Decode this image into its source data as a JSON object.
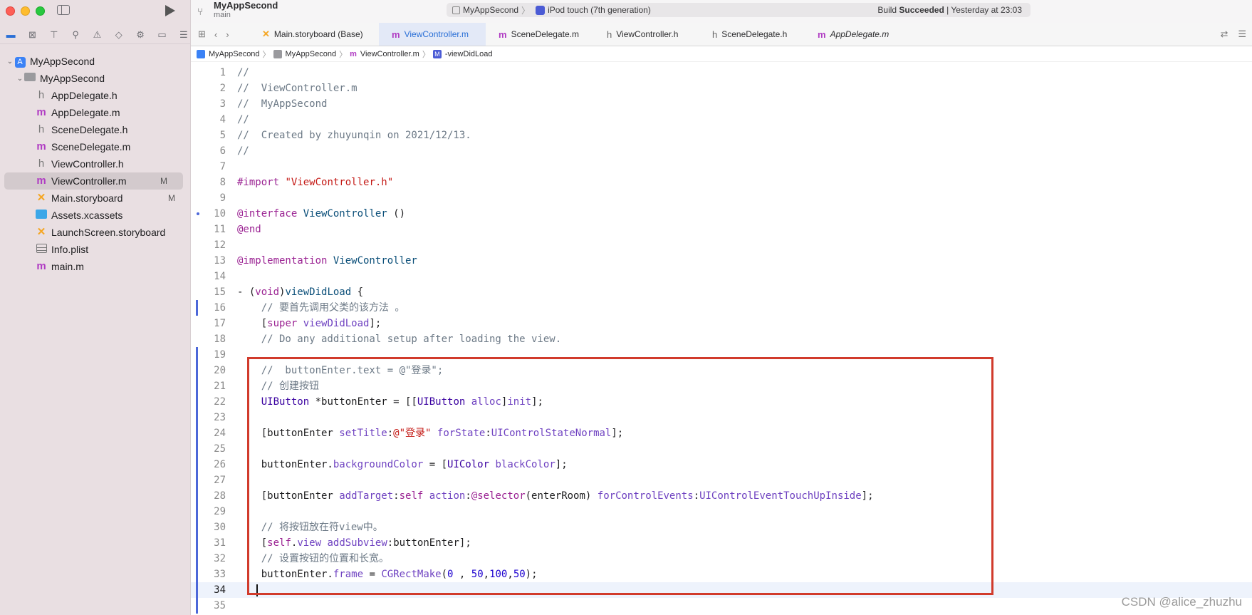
{
  "window": {
    "title": "MyAppSecond",
    "branch": "main"
  },
  "toolbar": {
    "scheme_name": "MyAppSecond",
    "device_name": "iPod touch (7th generation)",
    "build_prefix": "Build ",
    "build_result": "Succeeded",
    "build_time": " | Yesterday at 23:03"
  },
  "navigator": {
    "icons": [
      "folder-icon",
      "source-control-icon",
      "hierarchy-icon",
      "search-icon",
      "warning-icon",
      "test-icon",
      "debug-icon",
      "breakpoint-icon",
      "report-icon"
    ]
  },
  "tree": {
    "project": "MyAppSecond",
    "group": "MyAppSecond",
    "files": [
      {
        "name": "AppDelegate.h",
        "kind": "h",
        "badge": ""
      },
      {
        "name": "AppDelegate.m",
        "kind": "m",
        "badge": ""
      },
      {
        "name": "SceneDelegate.h",
        "kind": "h",
        "badge": ""
      },
      {
        "name": "SceneDelegate.m",
        "kind": "m",
        "badge": ""
      },
      {
        "name": "ViewController.h",
        "kind": "h",
        "badge": ""
      },
      {
        "name": "ViewController.m",
        "kind": "m",
        "badge": "M"
      },
      {
        "name": "Main.storyboard",
        "kind": "storyboard",
        "badge": "M"
      },
      {
        "name": "Assets.xcassets",
        "kind": "assets",
        "badge": ""
      },
      {
        "name": "LaunchScreen.storyboard",
        "kind": "storyboard",
        "badge": ""
      },
      {
        "name": "Info.plist",
        "kind": "plist",
        "badge": ""
      },
      {
        "name": "main.m",
        "kind": "m",
        "badge": ""
      }
    ]
  },
  "tabs": [
    {
      "label": "Main.storyboard (Base)",
      "icon": "X"
    },
    {
      "label": "ViewController.m",
      "icon": "m"
    },
    {
      "label": "SceneDelegate.m",
      "icon": "m"
    },
    {
      "label": "ViewController.h",
      "icon": "h"
    },
    {
      "label": "SceneDelegate.h",
      "icon": "h"
    },
    {
      "label": "AppDelegate.m",
      "icon": "m"
    }
  ],
  "jumpbar": [
    "MyAppSecond",
    "MyAppSecond",
    "ViewController.m",
    "-viewDidLoad"
  ],
  "editor": {
    "lines": [
      {
        "n": "1",
        "t": [
          [
            "cm",
            "//"
          ]
        ]
      },
      {
        "n": "2",
        "t": [
          [
            "cm",
            "//  ViewController.m"
          ]
        ]
      },
      {
        "n": "3",
        "t": [
          [
            "cm",
            "//  MyAppSecond"
          ]
        ]
      },
      {
        "n": "4",
        "t": [
          [
            "cm",
            "//"
          ]
        ]
      },
      {
        "n": "5",
        "t": [
          [
            "cm",
            "//  Created by zhuyunqin on 2021/12/13."
          ]
        ]
      },
      {
        "n": "6",
        "t": [
          [
            "cm",
            "//"
          ]
        ]
      },
      {
        "n": "7",
        "t": []
      },
      {
        "n": "8",
        "t": [
          [
            "kw",
            "#import "
          ],
          [
            "str",
            "\"ViewController.h\""
          ]
        ]
      },
      {
        "n": "9",
        "t": []
      },
      {
        "n": "10",
        "t": [
          [
            "kw",
            "@interface "
          ],
          [
            "ty",
            "ViewController"
          ],
          [
            "plain",
            " ()"
          ]
        ]
      },
      {
        "n": "11",
        "t": [
          [
            "kw",
            "@end"
          ]
        ]
      },
      {
        "n": "12",
        "t": []
      },
      {
        "n": "13",
        "t": [
          [
            "kw",
            "@implementation "
          ],
          [
            "ty",
            "ViewController"
          ]
        ]
      },
      {
        "n": "14",
        "t": []
      },
      {
        "n": "15",
        "t": [
          [
            "plain",
            "- ("
          ],
          [
            "kw",
            "void"
          ],
          [
            "plain",
            ")"
          ],
          [
            "ty",
            "viewDidLoad"
          ],
          [
            "plain",
            " {"
          ]
        ]
      },
      {
        "n": "16",
        "t": [
          [
            "cm",
            "    // 要首先调用父类的该方法 。"
          ]
        ]
      },
      {
        "n": "17",
        "t": [
          [
            "plain",
            "    ["
          ],
          [
            "kw",
            "super"
          ],
          [
            "plain",
            " "
          ],
          [
            "mt",
            "viewDidLoad"
          ],
          [
            "plain",
            "];"
          ]
        ]
      },
      {
        "n": "18",
        "t": [
          [
            "cm",
            "    // Do any additional setup after loading the view."
          ]
        ]
      },
      {
        "n": "19",
        "t": []
      },
      {
        "n": "20",
        "t": [
          [
            "cm",
            "    //  buttonEnter.text = @\"登录\";"
          ]
        ]
      },
      {
        "n": "21",
        "t": [
          [
            "cm",
            "    // 创建按钮"
          ]
        ]
      },
      {
        "n": "22",
        "t": [
          [
            "cls",
            "    UIButton"
          ],
          [
            "plain",
            " *buttonEnter = [["
          ],
          [
            "cls",
            "UIButton"
          ],
          [
            "plain",
            " "
          ],
          [
            "mt",
            "alloc"
          ],
          [
            "plain",
            "]"
          ],
          [
            "mt",
            "init"
          ],
          [
            "plain",
            "];"
          ]
        ]
      },
      {
        "n": "23",
        "t": []
      },
      {
        "n": "24",
        "t": [
          [
            "plain",
            "    [buttonEnter "
          ],
          [
            "mt",
            "setTitle"
          ],
          [
            "plain",
            ":"
          ],
          [
            "str",
            "@\"登录\""
          ],
          [
            "plain",
            " "
          ],
          [
            "mt",
            "forState"
          ],
          [
            "plain",
            ":"
          ],
          [
            "mt",
            "UIControlStateNormal"
          ],
          [
            "plain",
            "];"
          ]
        ]
      },
      {
        "n": "25",
        "t": []
      },
      {
        "n": "26",
        "t": [
          [
            "plain",
            "    buttonEnter."
          ],
          [
            "mt",
            "backgroundColor"
          ],
          [
            "plain",
            " = ["
          ],
          [
            "cls",
            "UIColor"
          ],
          [
            "plain",
            " "
          ],
          [
            "mt",
            "blackColor"
          ],
          [
            "plain",
            "];"
          ]
        ]
      },
      {
        "n": "27",
        "t": []
      },
      {
        "n": "28",
        "t": [
          [
            "plain",
            "    [buttonEnter "
          ],
          [
            "mt",
            "addTarget"
          ],
          [
            "plain",
            ":"
          ],
          [
            "kw",
            "self"
          ],
          [
            "plain",
            " "
          ],
          [
            "mt",
            "action"
          ],
          [
            "plain",
            ":"
          ],
          [
            "kw",
            "@selector"
          ],
          [
            "plain",
            "(enterRoom) "
          ],
          [
            "mt",
            "forControlEvents"
          ],
          [
            "plain",
            ":"
          ],
          [
            "mt",
            "UIControlEventTouchUpInside"
          ],
          [
            "plain",
            "];"
          ]
        ]
      },
      {
        "n": "29",
        "t": []
      },
      {
        "n": "30",
        "t": [
          [
            "cm",
            "    // 将按钮放在符view中。"
          ]
        ]
      },
      {
        "n": "31",
        "t": [
          [
            "plain",
            "    ["
          ],
          [
            "kw",
            "self"
          ],
          [
            "plain",
            "."
          ],
          [
            "mt",
            "view"
          ],
          [
            "plain",
            " "
          ],
          [
            "mt",
            "addSubview"
          ],
          [
            "plain",
            ":buttonEnter];"
          ]
        ]
      },
      {
        "n": "32",
        "t": [
          [
            "cm",
            "    // 设置按钮的位置和长宽。"
          ]
        ]
      },
      {
        "n": "33",
        "t": [
          [
            "plain",
            "    buttonEnter."
          ],
          [
            "mt",
            "frame"
          ],
          [
            "plain",
            " = "
          ],
          [
            "mt",
            "CGRectMake"
          ],
          [
            "plain",
            "("
          ],
          [
            "num",
            "0"
          ],
          [
            "plain",
            " , "
          ],
          [
            "num",
            "50"
          ],
          [
            "plain",
            ","
          ],
          [
            "num",
            "100"
          ],
          [
            "plain",
            ","
          ],
          [
            "num",
            "50"
          ],
          [
            "plain",
            ");"
          ]
        ]
      },
      {
        "n": "34",
        "t": [],
        "current": true
      },
      {
        "n": "35",
        "t": []
      }
    ]
  },
  "watermark": "CSDN @alice_zhuzhu",
  "colors": {
    "accent": "#2a6fd6",
    "highlight_box": "#d13b2c",
    "change_bar": "#4d68d9"
  }
}
